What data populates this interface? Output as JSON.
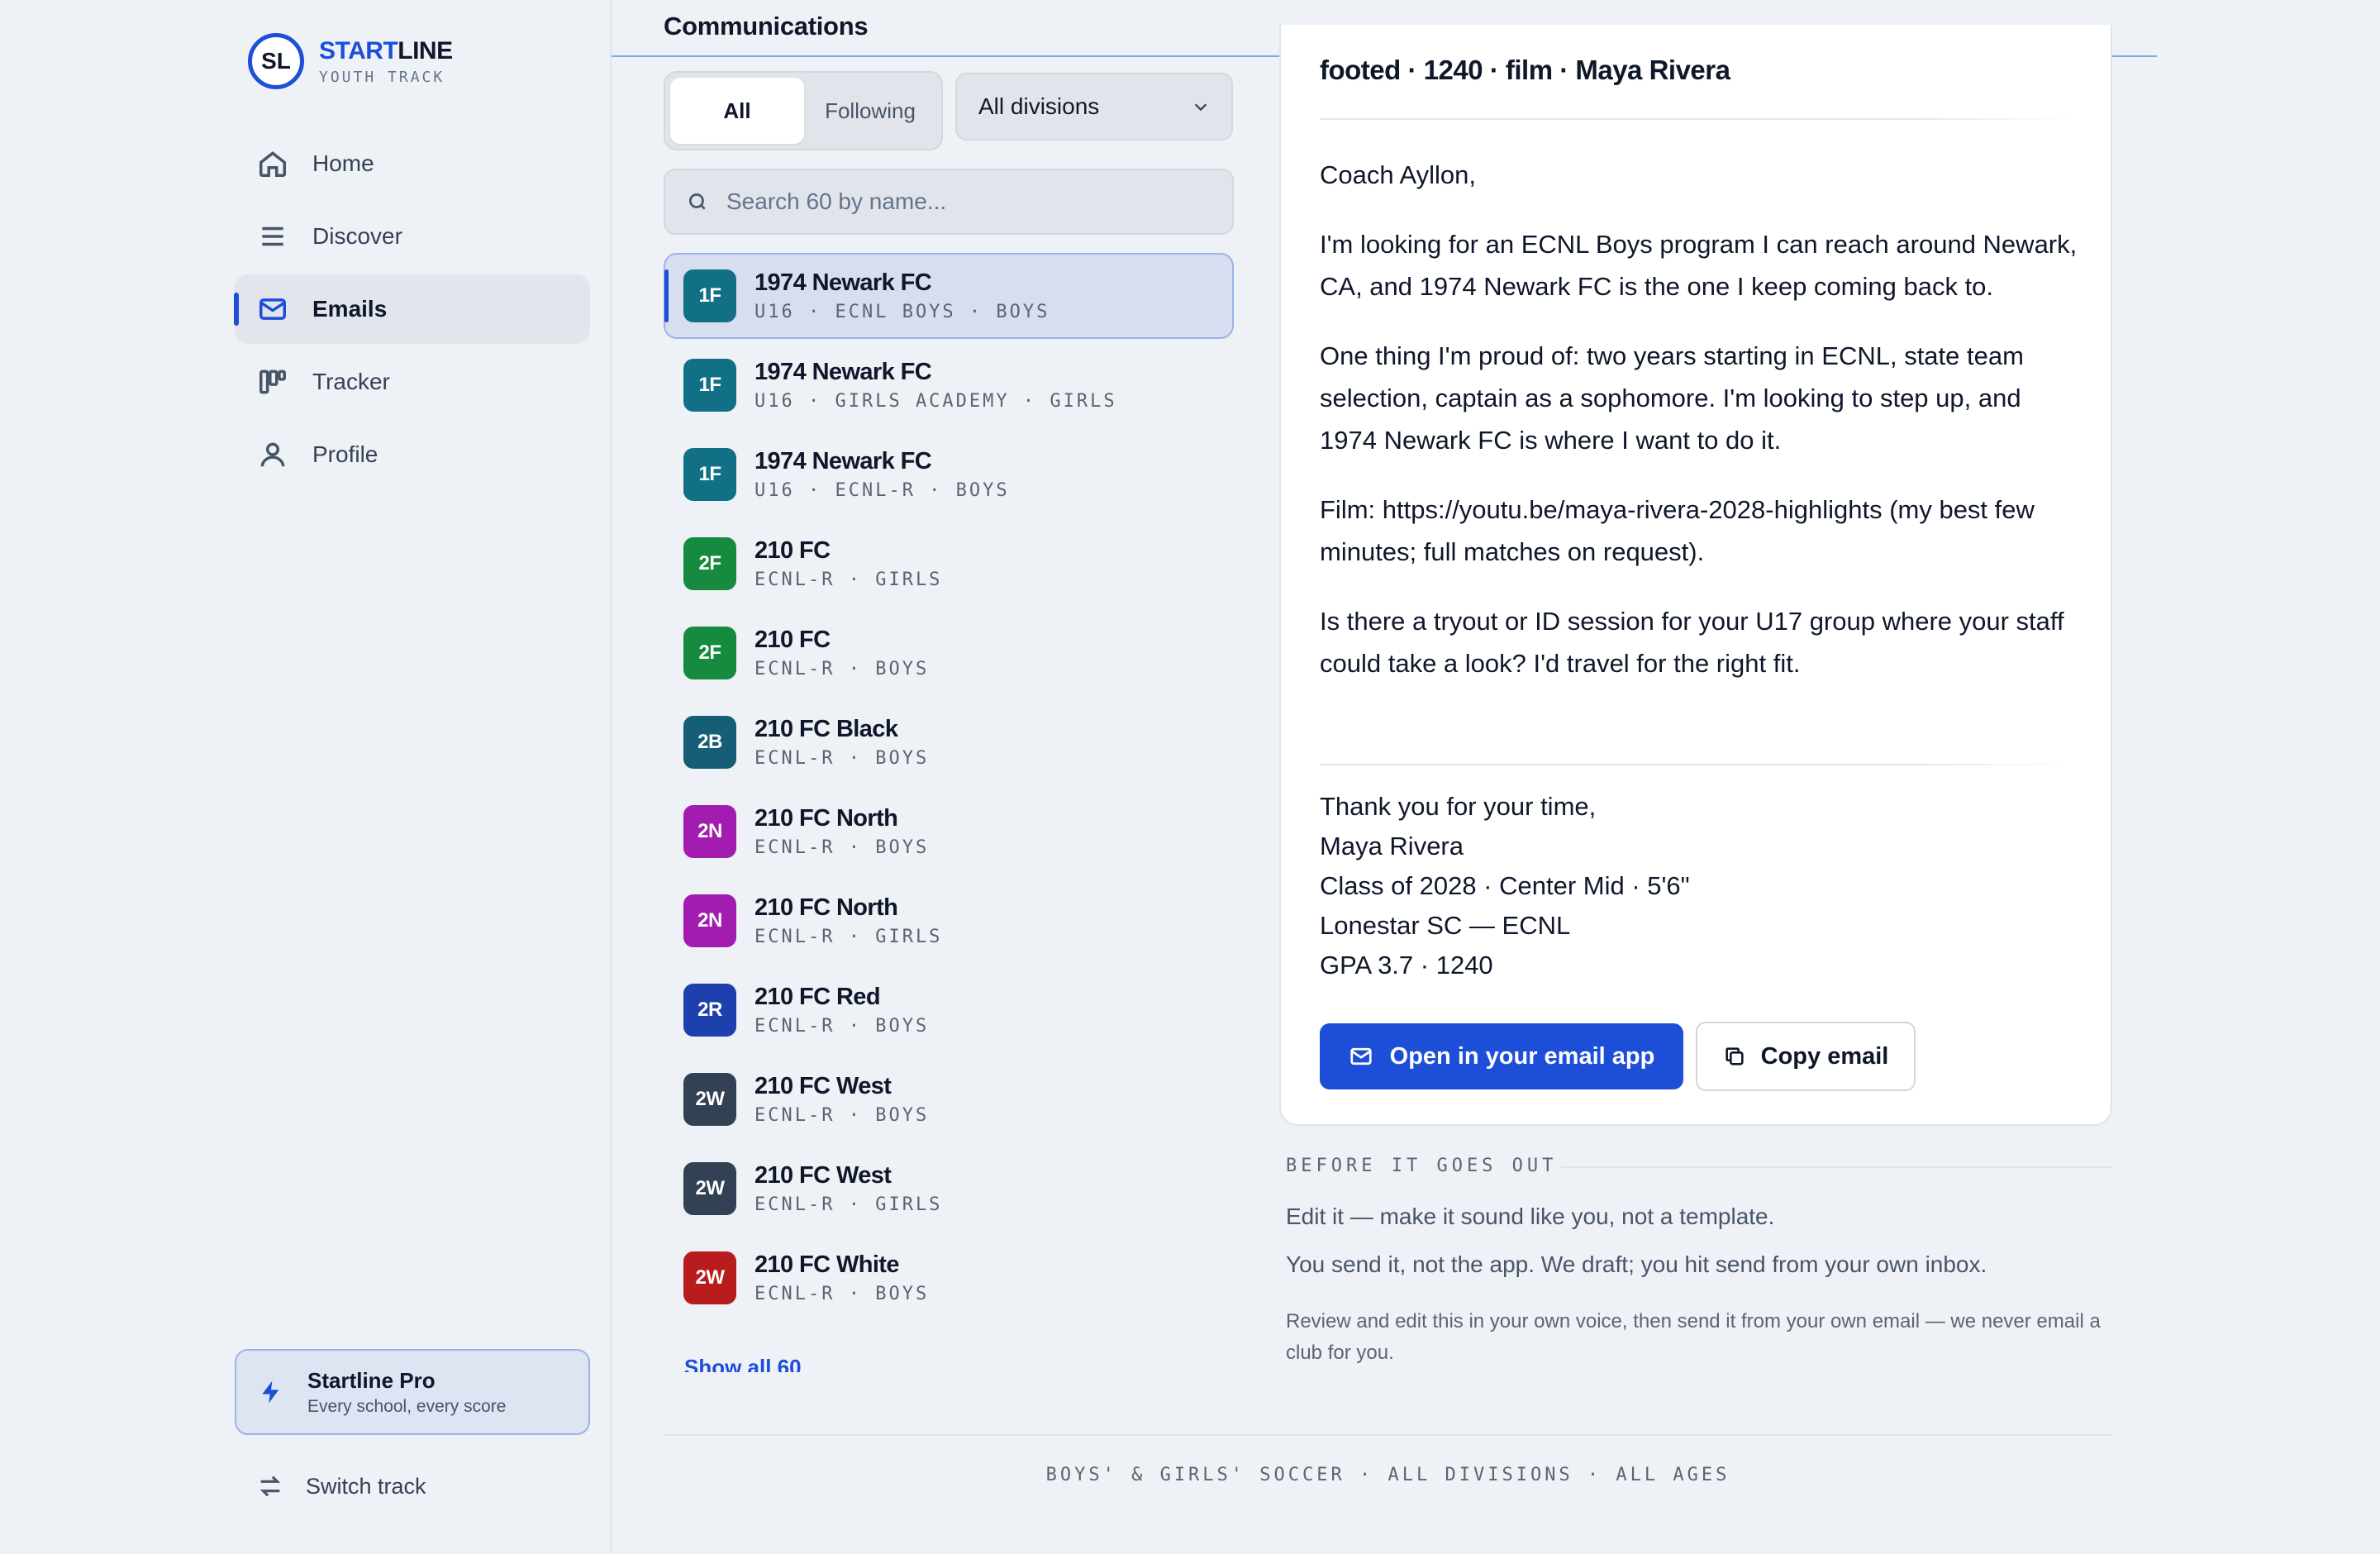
{
  "brand": {
    "mark": "SL",
    "title_a": "START",
    "title_b": "LINE",
    "subtitle": "YOUTH TRACK"
  },
  "nav": {
    "items": [
      {
        "label": "Home",
        "icon": "home-icon"
      },
      {
        "label": "Discover",
        "icon": "menu-icon"
      },
      {
        "label": "Emails",
        "icon": "mail-icon",
        "active": true
      },
      {
        "label": "Tracker",
        "icon": "kanban-icon"
      },
      {
        "label": "Profile",
        "icon": "user-icon"
      }
    ]
  },
  "pro": {
    "title": "Startline Pro",
    "subtitle": "Every school, every score"
  },
  "switch_track": "Switch track",
  "header": {
    "title": "Communications"
  },
  "filters": {
    "tabs": [
      "All",
      "Following"
    ],
    "active_tab": "All",
    "division": "All divisions"
  },
  "search": {
    "placeholder": "Search 60 by name..."
  },
  "clubs": [
    {
      "badge": "1F",
      "color": "#127086",
      "name": "1974 Newark FC",
      "meta": "U16 · ECNL BOYS · BOYS",
      "selected": true
    },
    {
      "badge": "1F",
      "color": "#127086",
      "name": "1974 Newark FC",
      "meta": "U16 · GIRLS ACADEMY · GIRLS"
    },
    {
      "badge": "1F",
      "color": "#127086",
      "name": "1974 Newark FC",
      "meta": "U16 · ECNL-R · BOYS"
    },
    {
      "badge": "2F",
      "color": "#168a3f",
      "name": "210 FC",
      "meta": "ECNL-R · GIRLS"
    },
    {
      "badge": "2F",
      "color": "#168a3f",
      "name": "210 FC",
      "meta": "ECNL-R · BOYS"
    },
    {
      "badge": "2B",
      "color": "#155e75",
      "name": "210 FC Black",
      "meta": "ECNL-R · BOYS"
    },
    {
      "badge": "2N",
      "color": "#a21caf",
      "name": "210 FC North",
      "meta": "ECNL-R · BOYS"
    },
    {
      "badge": "2N",
      "color": "#a21caf",
      "name": "210 FC North",
      "meta": "ECNL-R · GIRLS"
    },
    {
      "badge": "2R",
      "color": "#1e40af",
      "name": "210 FC Red",
      "meta": "ECNL-R · BOYS"
    },
    {
      "badge": "2W",
      "color": "#334155",
      "name": "210 FC West",
      "meta": "ECNL-R · BOYS"
    },
    {
      "badge": "2W",
      "color": "#334155",
      "name": "210 FC West",
      "meta": "ECNL-R · GIRLS"
    },
    {
      "badge": "2W",
      "color": "#b91c1c",
      "name": "210 FC White",
      "meta": "ECNL-R · BOYS"
    }
  ],
  "show_all": "Show all 60",
  "email": {
    "subject": "footed · 1240 · film · Maya Rivera",
    "paragraphs": [
      "Coach Ayllon,",
      "I'm looking for an ECNL Boys program I can reach around Newark, CA, and 1974 Newark FC is the one I keep coming back to.",
      "One thing I'm proud of: two years starting in ECNL, state team selection, captain as a sophomore. I'm looking to step up, and 1974 Newark FC is where I want to do it.",
      "Film: https://youtu.be/maya-rivera-2028-highlights (my best few minutes; full matches on request).",
      "Is there a tryout or ID session for your U17 group where your staff could take a look? I'd travel for the right fit."
    ],
    "signature": [
      "Thank you for your time,",
      "Maya Rivera",
      "Class of 2028 · Center Mid · 5'6\"",
      "Lonestar SC — ECNL",
      "GPA 3.7 · 1240"
    ],
    "open_button": "Open in your email app",
    "copy_button": "Copy email"
  },
  "before": {
    "label": "BEFORE IT GOES OUT",
    "tips": [
      "Edit it — make it sound like you, not a template.",
      "You send it, not the app. We draft; you hit send from your own inbox."
    ],
    "note": "Review and edit this in your own voice, then send it from your own email — we never email a club for you."
  },
  "footer": "BOYS' & GIRLS' SOCCER · ALL DIVISIONS · ALL AGES",
  "colors": {
    "accent": "#1d4ed8",
    "background": "#eef1f5"
  }
}
